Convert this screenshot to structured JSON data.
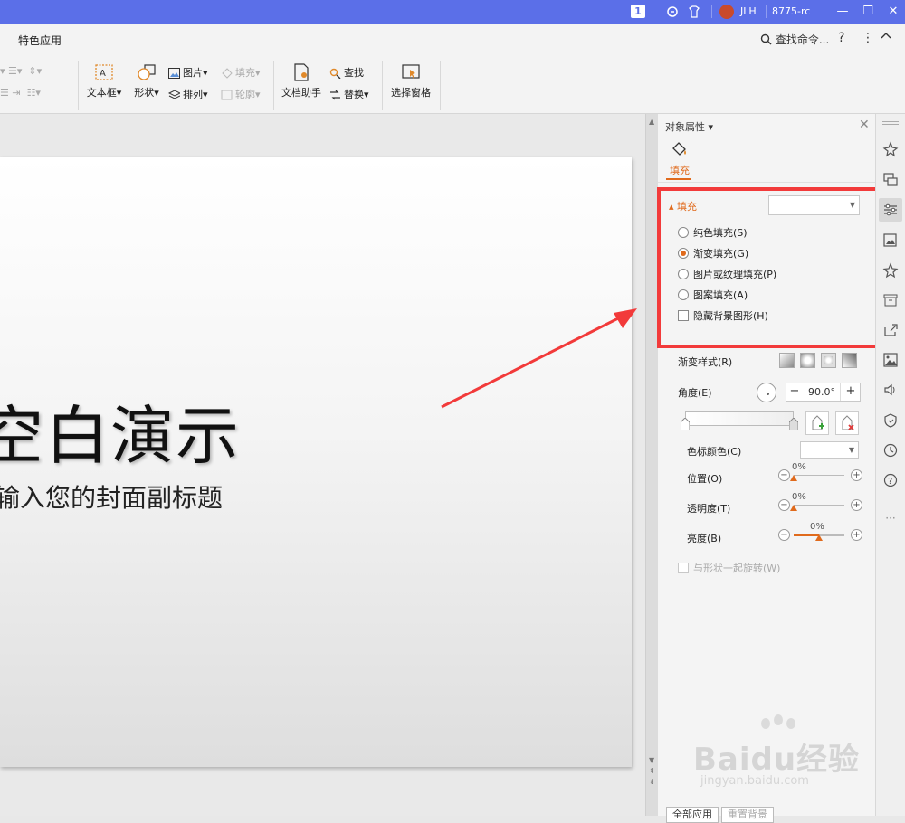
{
  "titlebar": {
    "badge": "1",
    "user": "JLH",
    "build": "8775-rc",
    "bg_color": "#5b6fe8"
  },
  "menubar": {
    "active_tab": "特色应用",
    "search_label": "查找命令...",
    "help": "?",
    "more": "⋮",
    "collapse": "^"
  },
  "ribbon": {
    "textbox": "文本框",
    "shape": "形状",
    "picture": "图片",
    "fill": "填充",
    "arrange": "排列",
    "outline": "轮廓",
    "doc_helper": "文档助手",
    "find": "查找",
    "replace": "替换",
    "select_pane": "选择窗格"
  },
  "slide": {
    "title": "空白演示",
    "subtitle": "输入您的封面副标题"
  },
  "panel": {
    "title": "对象属性",
    "tab_fill": "填充",
    "section_fill": "填充",
    "options": [
      {
        "label": "纯色填充(S)",
        "checked": false
      },
      {
        "label": "渐变填充(G)",
        "checked": true
      },
      {
        "label": "图片或纹理填充(P)",
        "checked": false
      },
      {
        "label": "图案填充(A)",
        "checked": false
      }
    ],
    "hide_bg": "隐藏背景图形(H)",
    "gradient_style": "渐变样式(R)",
    "angle_label": "角度(E)",
    "angle_value": "90.0°",
    "stop_color": "色标颜色(C)",
    "position": {
      "label": "位置(O)",
      "value": "0%"
    },
    "transparency": {
      "label": "透明度(T)",
      "value": "0%"
    },
    "brightness": {
      "label": "亮度(B)",
      "value": "0%"
    },
    "rotate_with_shape": "与形状一起旋转(W)",
    "apply_all": "全部应用",
    "reset_bg": "重置背景",
    "accent_color": "#e06a1c",
    "highlight_color": "#f23a3a"
  },
  "watermark": {
    "brand": "Baidu经验",
    "url": "jingyan.baidu.com"
  }
}
